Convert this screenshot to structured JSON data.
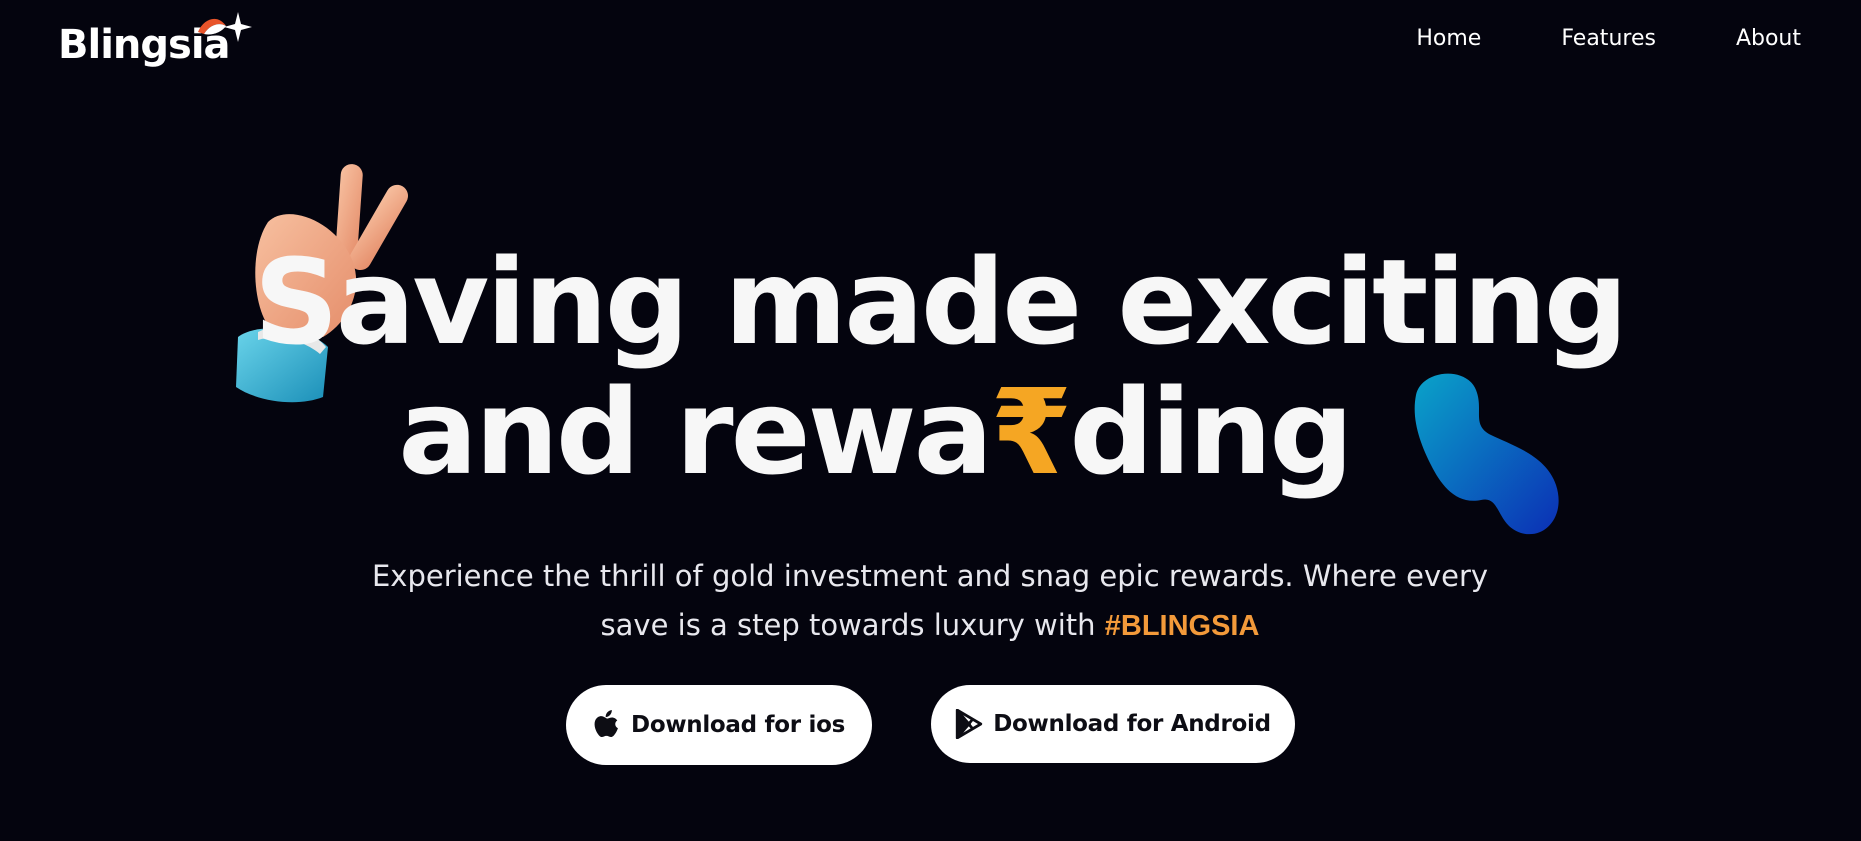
{
  "header": {
    "logo_text": "Blingsia",
    "nav": [
      {
        "label": "Home"
      },
      {
        "label": "Features"
      },
      {
        "label": "About"
      }
    ]
  },
  "hero": {
    "line1": "Saving made exciting",
    "line2_start": "and rewa",
    "line2_rupee": "₹",
    "line2_end": "ding",
    "subtitle_line1": "Experience the thrill of gold investment and snag epic rewards. Where every",
    "subtitle_line2": "save is a step towards luxury with ",
    "hashtag": "#BLINGSIA"
  },
  "buttons": {
    "ios_label": "Download for ios",
    "android_label": "Download for Android"
  },
  "colors": {
    "background": "#04040e",
    "accent_orange": "#f5a623",
    "hashtag_orange": "#f39a3a",
    "blob_cyan": "#0aa3c9",
    "blob_blue": "#0b2fb5"
  },
  "icons": {
    "logo_mark": "sparkle-icon",
    "hand": "peace-hand-icon",
    "blob": "blue-blob-shape",
    "ios_button": "apple-icon",
    "android_button": "google-play-icon"
  }
}
